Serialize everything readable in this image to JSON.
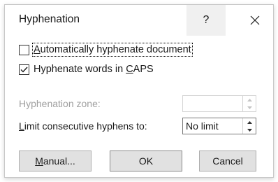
{
  "dialog": {
    "title": "Hyphenation",
    "help_glyph": "?",
    "close_icon": "close-icon"
  },
  "options": {
    "auto_hyphenate": {
      "pre": "",
      "acc": "A",
      "post": "utomatically hyphenate document",
      "checked": false
    },
    "caps": {
      "pre": "Hyphenate words in ",
      "acc": "C",
      "post": "APS",
      "checked": true
    }
  },
  "zone": {
    "label": "Hyphenation zone:",
    "value": ""
  },
  "limit": {
    "pre": "",
    "acc": "L",
    "post": "imit consecutive hyphens to:",
    "value": "No limit"
  },
  "buttons": {
    "manual": {
      "pre": "",
      "acc": "M",
      "post": "anual..."
    },
    "ok": "OK",
    "cancel": "Cancel"
  }
}
